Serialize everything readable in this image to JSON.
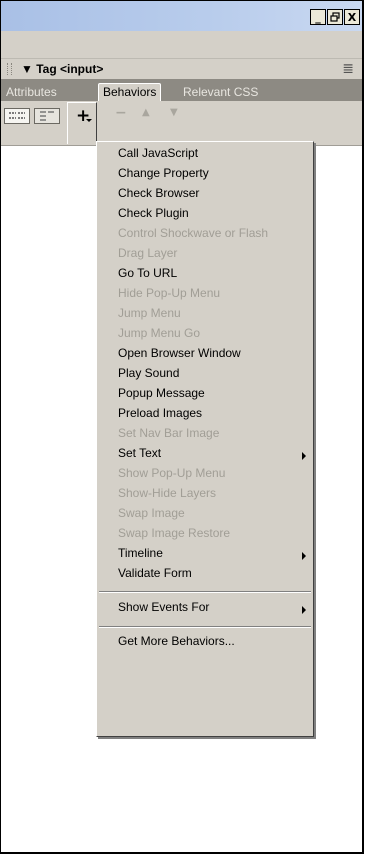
{
  "window": {
    "minimize_glyph": "_",
    "restore_glyph": "❐",
    "close_glyph": "X"
  },
  "panel": {
    "title": "▼ Tag <input>",
    "options_icon": "≣"
  },
  "tabs": [
    {
      "label": "Attributes",
      "active": false
    },
    {
      "label": "Behaviors",
      "active": true
    },
    {
      "label": "Relevant CSS",
      "active": false
    }
  ],
  "toolbar": {
    "add_glyph": "+",
    "remove_glyph": "−",
    "up_glyph": "▲",
    "down_glyph": "▼"
  },
  "menu": {
    "items": [
      {
        "label": "Call JavaScript",
        "enabled": true
      },
      {
        "label": "Change Property",
        "enabled": true
      },
      {
        "label": "Check Browser",
        "enabled": true
      },
      {
        "label": "Check Plugin",
        "enabled": true
      },
      {
        "label": "Control Shockwave or Flash",
        "enabled": false
      },
      {
        "label": "Drag Layer",
        "enabled": false
      },
      {
        "label": "Go To URL",
        "enabled": true
      },
      {
        "label": "Hide Pop-Up Menu",
        "enabled": false
      },
      {
        "label": "Jump Menu",
        "enabled": false
      },
      {
        "label": "Jump Menu Go",
        "enabled": false
      },
      {
        "label": "Open Browser Window",
        "enabled": true
      },
      {
        "label": "Play Sound",
        "enabled": true
      },
      {
        "label": "Popup Message",
        "enabled": true
      },
      {
        "label": "Preload Images",
        "enabled": true
      },
      {
        "label": "Set Nav Bar Image",
        "enabled": false
      },
      {
        "label": "Set Text",
        "enabled": true,
        "submenu": true
      },
      {
        "label": "Show Pop-Up Menu",
        "enabled": false
      },
      {
        "label": "Show-Hide Layers",
        "enabled": false
      },
      {
        "label": "Swap Image",
        "enabled": false
      },
      {
        "label": "Swap Image Restore",
        "enabled": false
      },
      {
        "label": "Timeline",
        "enabled": true,
        "submenu": true
      },
      {
        "label": "Validate Form",
        "enabled": true
      }
    ],
    "show_events_for": "Show Events For",
    "get_more": "Get More Behaviors..."
  }
}
